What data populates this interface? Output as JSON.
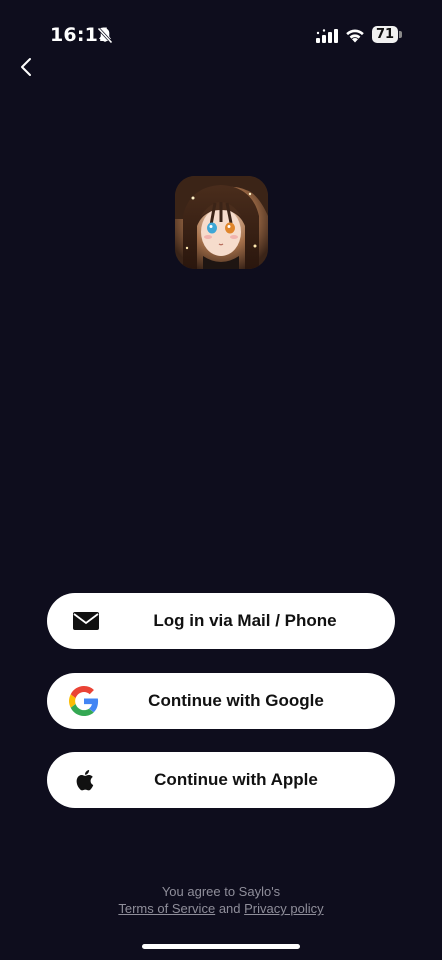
{
  "status_bar": {
    "time": "16:11",
    "battery": "71",
    "icons": [
      "bell-off-icon",
      "signal-icon",
      "wifi-icon",
      "battery-icon"
    ]
  },
  "nav": {
    "back_icon": "chevron-left-icon"
  },
  "logo": {
    "alt": "anime-girl-app-logo"
  },
  "buttons": {
    "mail": {
      "label": "Log in via Mail / Phone",
      "icon": "mail-icon"
    },
    "google": {
      "label": "Continue with Google",
      "icon": "google-icon"
    },
    "apple": {
      "label": "Continue with Apple",
      "icon": "apple-icon"
    }
  },
  "footer": {
    "agree_text": "You agree to Saylo's",
    "terms_link": "Terms of Service",
    "and_text": "and",
    "privacy_link": "Privacy policy"
  },
  "colors": {
    "background": "#0e0d1d",
    "button_bg": "#ffffff",
    "footer_text": "#8f8e9a"
  }
}
